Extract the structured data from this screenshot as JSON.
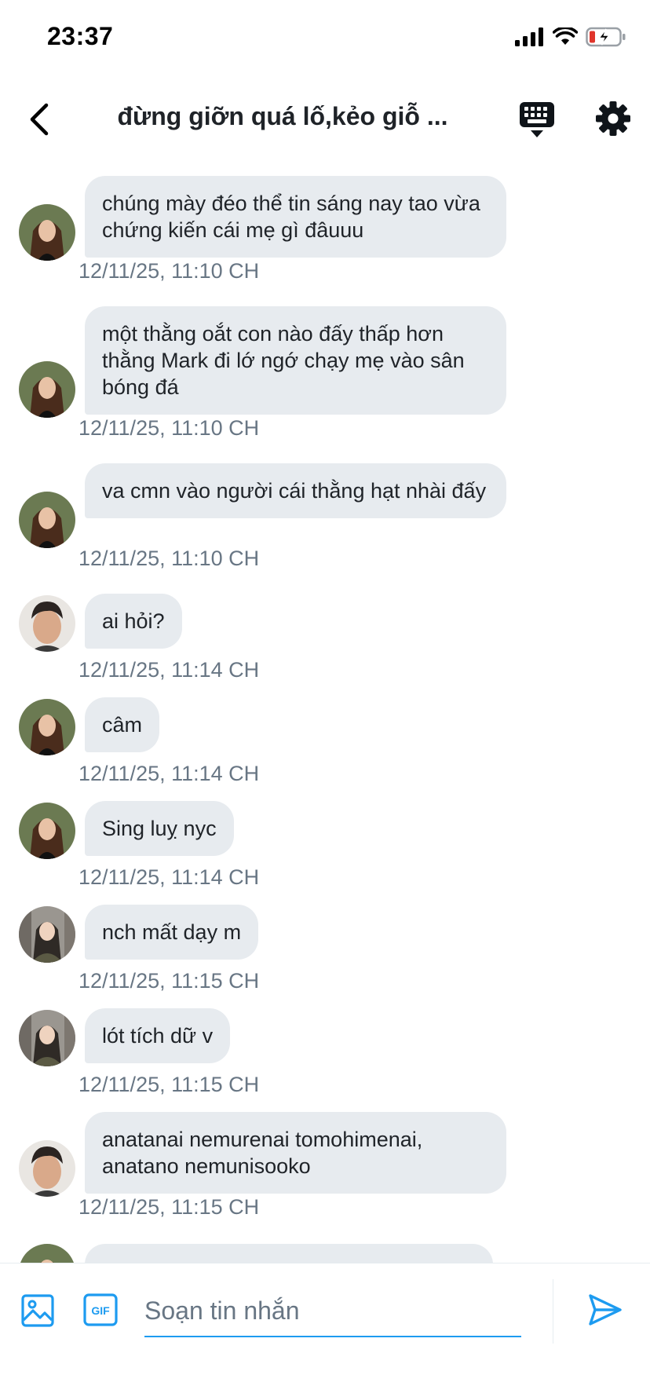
{
  "status_bar": {
    "time": "23:37"
  },
  "header": {
    "title": "đừng giỡn quá lố,kẻo giỗ ..."
  },
  "colors": {
    "accent": "#1d9bf0",
    "bubble": "#e7ebef",
    "timestamp": "#687684",
    "battery_low": "#e0352b"
  },
  "messages": [
    {
      "avatar": "girl-long-hair",
      "text": "chúng mày đéo thể tin sáng nay tao vừa chứng kiến cái mẹ gì đâuuu",
      "time": "12/11/25, 11:10 CH"
    },
    {
      "avatar": "girl-long-hair",
      "text": "một thằng oắt con nào đấy thấp hơn thằng Mark đi lớ ngớ chạy mẹ vào sân bóng đá",
      "time": "12/11/25, 11:10 CH"
    },
    {
      "avatar": "girl-long-hair",
      "text": "va cmn vào người cái thằng hạt nhài đấy",
      "time": "12/11/25, 11:10 CH"
    },
    {
      "avatar": "boy-selfie",
      "text": "ai hỏi?",
      "time": "12/11/25, 11:14 CH"
    },
    {
      "avatar": "girl-long-hair",
      "text": "câm",
      "time": "12/11/25, 11:14 CH"
    },
    {
      "avatar": "girl-long-hair",
      "text": "Sing luỵ nyc",
      "time": "12/11/25, 11:14 CH"
    },
    {
      "avatar": "girl-street",
      "text": "nch mất dạy m",
      "time": "12/11/25, 11:15 CH"
    },
    {
      "avatar": "girl-street",
      "text": "lót tích dữ v",
      "time": "12/11/25, 11:15 CH"
    },
    {
      "avatar": "boy-selfie",
      "text": "anatanai nemurenai tomohimenai, anatano nemunisooko",
      "time": "12/11/25, 11:15 CH"
    }
  ],
  "composer": {
    "placeholder": "Soạn tin nhắn"
  },
  "icons": {
    "back": "chevron-left-icon",
    "keyboard": "keyboard-icon",
    "settings": "gear-icon",
    "image": "image-icon",
    "gif": "gif-icon",
    "send": "send-icon"
  }
}
